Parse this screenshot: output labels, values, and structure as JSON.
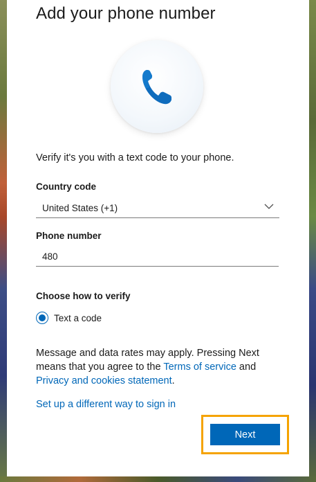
{
  "dialog": {
    "title": "Add your phone number",
    "intro": "Verify it's you with a text code to your phone.",
    "country": {
      "label": "Country code",
      "value": "United States (+1)"
    },
    "phone": {
      "label": "Phone number",
      "value": "480"
    },
    "verify": {
      "label": "Choose how to verify",
      "option": "Text a code",
      "selected": true
    },
    "disclaimer": {
      "text_before": "Message and data rates may apply. Pressing Next means that you agree to the ",
      "terms_link": "Terms of service",
      "text_middle": " and ",
      "privacy_link": "Privacy and cookies statement",
      "text_after": "."
    },
    "alt_link": "Set up a different way to sign in",
    "next_label": "Next"
  },
  "icons": {
    "phone": "phone-icon",
    "chevron": "chevron-down-icon"
  },
  "colors": {
    "accent": "#0067b8",
    "highlight": "#f5a300"
  }
}
